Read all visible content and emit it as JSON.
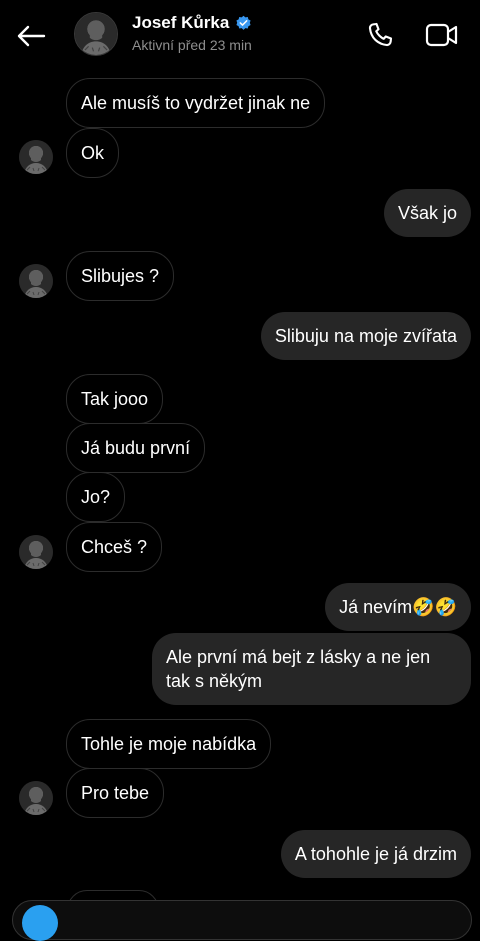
{
  "header": {
    "back_icon": "arrow-left-icon",
    "contact_name": "Josef Kůrka",
    "verified_icon": "verified-badge-icon",
    "status": "Aktivní před 23 min",
    "call_icon": "phone-icon",
    "video_icon": "video-camera-icon"
  },
  "messages": [
    {
      "text": "Ale musíš to vydržet jinak ne",
      "direction": "incoming"
    },
    {
      "text": "Ok",
      "direction": "incoming"
    },
    {
      "text": "Však jo",
      "direction": "outgoing"
    },
    {
      "text": "Slibujes ?",
      "direction": "incoming"
    },
    {
      "text": "Slibuju na moje zvířata",
      "direction": "outgoing"
    },
    {
      "text": "Tak jooo",
      "direction": "incoming"
    },
    {
      "text": "Já budu první",
      "direction": "incoming"
    },
    {
      "text": "Jo?",
      "direction": "incoming"
    },
    {
      "text": "Chceš ?",
      "direction": "incoming"
    },
    {
      "text": "Já nevím🤣🤣",
      "direction": "outgoing"
    },
    {
      "text": "Ale první má bejt z lásky a ne jen tak s někým",
      "direction": "outgoing"
    },
    {
      "text": "Tohle je moje nabídka",
      "direction": "incoming"
    },
    {
      "text": "Pro tebe",
      "direction": "incoming"
    },
    {
      "text": "A tohohle je já drzim",
      "direction": "outgoing"
    }
  ],
  "colors": {
    "background": "#000000",
    "incoming_border": "#2c2c2c",
    "outgoing_bg": "#262626",
    "muted_text": "#8e8e8e",
    "verified_blue": "#3897f0"
  }
}
